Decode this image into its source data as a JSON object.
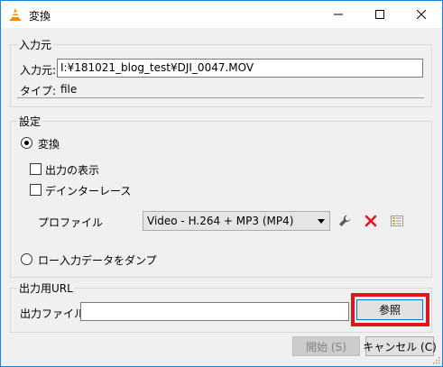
{
  "window": {
    "title": "変換"
  },
  "source": {
    "group_label": "入力元",
    "source_label": "入力元:",
    "source_value": "I:¥181021_blog_test¥DJI_0047.MOV",
    "type_label": "タイプ:",
    "type_value": "file"
  },
  "settings": {
    "group_label": "設定",
    "convert_label": "変換",
    "show_output_label": "出力の表示",
    "deinterlace_label": "デインターレース",
    "profile_label": "プロファイル",
    "profile_value": "Video - H.264 + MP3 (MP4)",
    "dump_label": "ロー入力データをダンプ"
  },
  "destination": {
    "group_label": "出力用URL",
    "file_label": "出力ファイル:",
    "file_value": "",
    "browse_label": "参照"
  },
  "buttons": {
    "start_label": "開始 (S)",
    "cancel_label": "キャンセル (C)"
  },
  "colors": {
    "accent": "#0078d7",
    "highlight": "#e0141e",
    "delete": "#e81123"
  }
}
